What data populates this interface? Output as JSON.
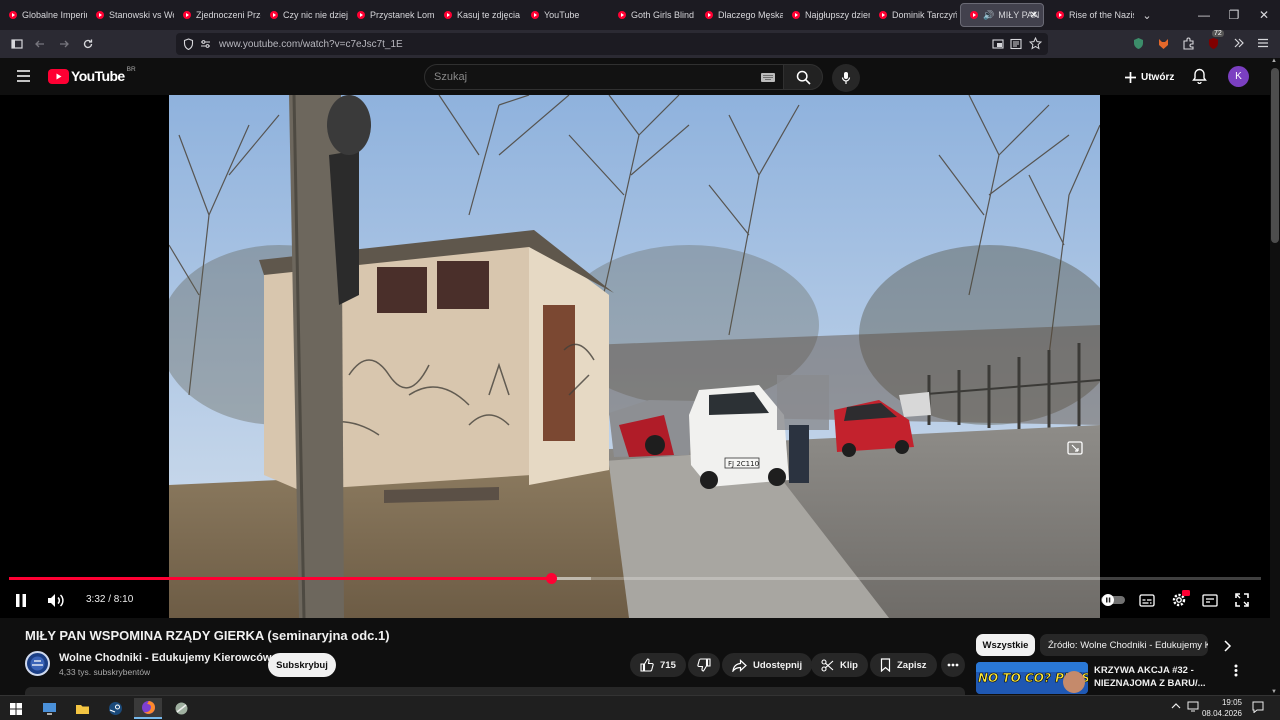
{
  "browser": {
    "tabs": [
      {
        "label": "Globalne Imperium"
      },
      {
        "label": "Stanowski vs Wojewódzki"
      },
      {
        "label": "Zjednoczeni Przeciwko"
      },
      {
        "label": "Czy nic nie dzieje"
      },
      {
        "label": "Przystanek Lombard"
      },
      {
        "label": "Kasuj te zdjęcia"
      },
      {
        "label": "YouTube"
      },
      {
        "label": "Goth Girls Blind"
      },
      {
        "label": "Dlaczego Męska"
      },
      {
        "label": "Najgłupszy dzień"
      },
      {
        "label": "Dominik Tarczyński"
      },
      {
        "label": "MIŁY PAN",
        "active": true
      },
      {
        "label": "Rise of the Nazis"
      }
    ],
    "url": "www.youtube.com/watch?v=c7eJsc7t_1E",
    "extension_badge": "72"
  },
  "youtube": {
    "logo_text": "YouTube",
    "logo_region": "BR",
    "search_placeholder": "Szukaj",
    "create_label": "Utwórz",
    "avatar_letter": "K"
  },
  "player": {
    "current_time": "3:32",
    "duration": "8:10",
    "time_display": "3:32 / 8:10",
    "progress_fraction": 0.433,
    "buffered_fraction": 0.465,
    "license_plate": "FJ 2C110"
  },
  "video": {
    "title": "MIŁY PAN WSPOMINA RZĄDY GIERKA (seminaryjna odc.1)",
    "channel_name": "Wolne Chodniki - Edukujemy Kierowców",
    "subscribers": "4,33 tys. subskrybentów",
    "subscribe_label": "Subskrybuj",
    "likes": "715",
    "share_label": "Udostępnij",
    "clip_label": "Klip",
    "save_label": "Zapisz"
  },
  "sidebar": {
    "chips": [
      {
        "label": "Wszystkie",
        "active": true
      },
      {
        "label": "Źródło: Wolne Chodniki - Edukujemy Kierowców",
        "active": false
      }
    ],
    "recommendation": {
      "title": "KRZYWA AKCJA #32 - NIEZNAJOMA Z BARU/...",
      "thumb_text": "NO TO CO? PRESSING!"
    }
  },
  "taskbar": {
    "time": "19:05",
    "date": "08.04.2026"
  },
  "colors": {
    "accent": "#ff0033",
    "background": "#0f0f0f",
    "avatar": "#7b3fc1"
  }
}
